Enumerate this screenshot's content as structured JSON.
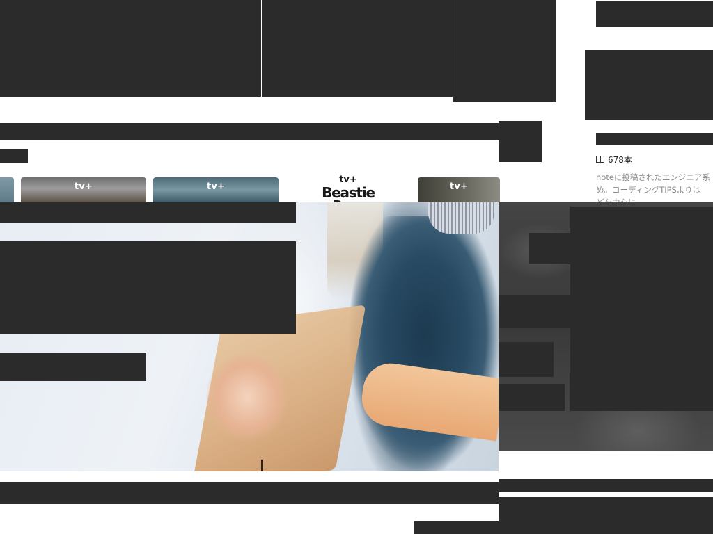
{
  "cards": {
    "brand": "tv+",
    "poster_title_1": "Beastie",
    "poster_title_2": "Boys"
  },
  "sidebar_magazine": {
    "count": "678本",
    "description": "noteに投稿されたエンジニア系\nめ。コーディングTIPSよりは\nどを中心に"
  },
  "icons": {
    "count": "book-icon",
    "brand": "apple-logo-icon"
  },
  "colors": {
    "redaction": "#2b2b2b",
    "muted_text": "#8a8a8a"
  }
}
